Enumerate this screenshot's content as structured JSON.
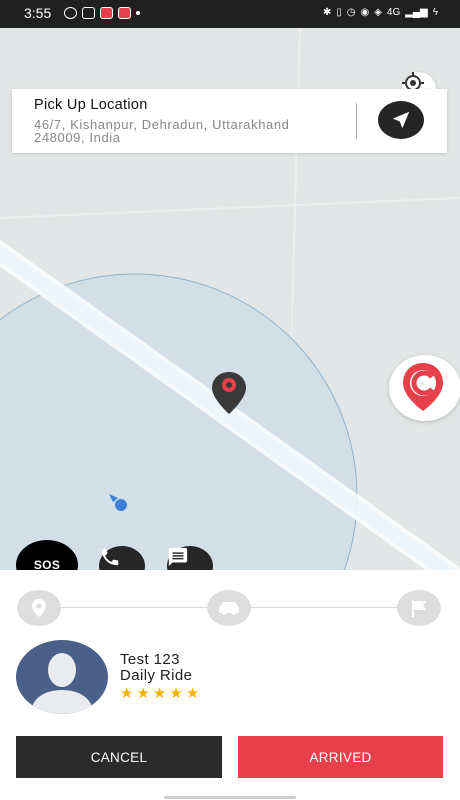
{
  "status_bar": {
    "time": "3:55",
    "network": "4G",
    "background": "#202020"
  },
  "pickup": {
    "title": "Pick Up Location",
    "address": "46/7, Kishanpur, Dehradun, Uttarakhand 248009, India"
  },
  "buttons": {
    "sos_label": "SOS",
    "cancel_label": "CANCEL",
    "arrived_label": "ARRIVED"
  },
  "driver": {
    "name": "Test 123",
    "ride_type": "Daily Ride",
    "rating_stars": 5
  },
  "icons": [
    "gps-locate-icon",
    "navigation-arrow-icon",
    "pin-marker-icon",
    "user-location-icon",
    "brand-logo-icon",
    "phone-icon",
    "chat-icon",
    "location-pin-icon",
    "car-icon",
    "finish-flag-icon",
    "avatar-silhouette-icon"
  ],
  "colors": {
    "accent": "#e8404a",
    "dark": "#2b2b2b",
    "map": "#e3e6e6",
    "circle": "#cfdde6",
    "star": "#f0b400"
  }
}
